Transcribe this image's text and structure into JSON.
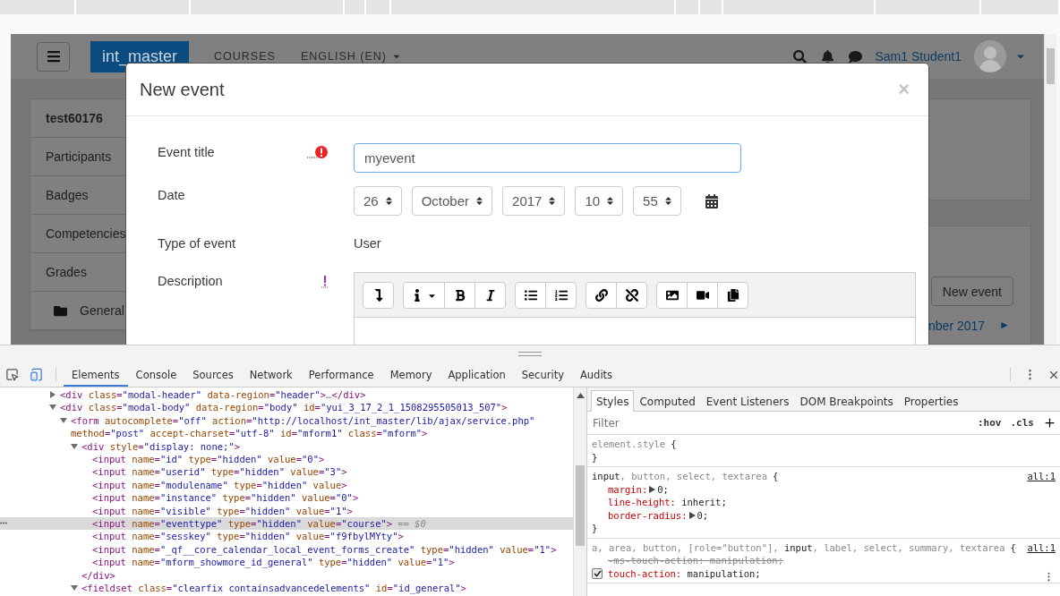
{
  "page": {
    "navbar": {
      "brand": "int_master",
      "links": [
        {
          "label": "COURSES"
        },
        {
          "label": "ENGLISH (EN)",
          "dropdown": true
        }
      ],
      "user_name": "Sam1 Student1"
    },
    "sidebar": {
      "items": [
        {
          "label": "test60176",
          "kind": "heading"
        },
        {
          "label": "Participants",
          "kind": "link"
        },
        {
          "label": "Badges",
          "kind": "link"
        },
        {
          "label": "Competencies",
          "kind": "link"
        },
        {
          "label": "Grades",
          "kind": "link"
        },
        {
          "label": "General",
          "kind": "folder"
        }
      ]
    },
    "calendar": {
      "button": "New event",
      "month": "nber 2017",
      "next": "►"
    }
  },
  "modal": {
    "title": "New event",
    "close": "×",
    "fields": [
      {
        "label": "Event title",
        "kind": "text",
        "error": true,
        "value": "myevent"
      },
      {
        "label": "Date",
        "kind": "date",
        "parts": [
          {
            "value": "26"
          },
          {
            "value": "October"
          },
          {
            "value": "2017"
          },
          {
            "value": "10"
          },
          {
            "value": "55"
          }
        ]
      },
      {
        "label": "Type of event",
        "kind": "static",
        "value": "User"
      },
      {
        "label": "Description",
        "kind": "editor",
        "required": true,
        "toolbar": [
          [
            {
              "kind": "collapse"
            }
          ],
          [
            {
              "kind": "info",
              "dropdown": true
            },
            {
              "kind": "bold"
            },
            {
              "kind": "italic"
            }
          ],
          [
            {
              "kind": "bullets"
            },
            {
              "kind": "numbering"
            }
          ],
          [
            {
              "kind": "link"
            },
            {
              "kind": "unlink"
            }
          ],
          [
            {
              "kind": "image"
            },
            {
              "kind": "video"
            },
            {
              "kind": "files"
            }
          ]
        ]
      }
    ]
  },
  "devtools": {
    "tabs": [
      {
        "label": "Elements",
        "selected": true
      },
      {
        "label": "Console",
        "selected": false
      },
      {
        "label": "Sources",
        "selected": false
      },
      {
        "label": "Network",
        "selected": false
      },
      {
        "label": "Performance",
        "selected": false
      },
      {
        "label": "Memory",
        "selected": false
      },
      {
        "label": "Application",
        "selected": false
      },
      {
        "label": "Security",
        "selected": false
      },
      {
        "label": "Audits",
        "selected": false
      }
    ],
    "dom_tree": [
      {
        "text": "<div class=\"modal-header\" data-region=\"header\">…</div>",
        "expanded": false,
        "selected": false
      },
      {
        "text": "<div class=\"modal-body\" data-region=\"body\" id=\"yui_3_17_2_1_1508295505013_507\">",
        "expanded": true,
        "selected": false,
        "children": [
          {
            "text": "<form autocomplete=\"off\" action=\"http://localhost/int_master/lib/ajax/service.php\" method=\"post\" accept-charset=\"utf-8\" id=\"mform1\" class=\"mform\">",
            "expanded": true,
            "selected": false,
            "children": [
              {
                "text": "<div style=\"display: none;\">",
                "expanded": true,
                "selected": false,
                "close": "</div>",
                "children": [
                  {
                    "text": "<input name=\"id\" type=\"hidden\" value=\"0\">",
                    "selected": false
                  },
                  {
                    "text": "<input name=\"userid\" type=\"hidden\" value=\"3\">",
                    "selected": false
                  },
                  {
                    "text": "<input name=\"modulename\" type=\"hidden\" value>",
                    "selected": false
                  },
                  {
                    "text": "<input name=\"instance\" type=\"hidden\" value=\"0\">",
                    "selected": false
                  },
                  {
                    "text": "<input name=\"visible\" type=\"hidden\" value=\"1\">",
                    "selected": false
                  },
                  {
                    "text": "<input name=\"eventtype\" type=\"hidden\" value=\"course\">",
                    "selected": true,
                    "badge": "== $0"
                  },
                  {
                    "text": "<input name=\"sesskey\" type=\"hidden\" value=\"f9fbylMYty\">",
                    "selected": false
                  },
                  {
                    "text": "<input name=\"_qf__core_calendar_local_event_forms_create\" type=\"hidden\" value=\"1\">",
                    "selected": false
                  },
                  {
                    "text": "<input name=\"mform_showmore_id_general\" type=\"hidden\" value=\"1\">",
                    "selected": false
                  }
                ]
              },
              {
                "text": "<fieldset class=\"clearfix containsadvancedelements\" id=\"id_general\">",
                "expanded": true,
                "selected": false
              }
            ]
          }
        ]
      }
    ],
    "styles": {
      "tabs": [
        {
          "label": "Styles",
          "selected": true
        },
        {
          "label": "Computed",
          "selected": false
        },
        {
          "label": "Event Listeners",
          "selected": false
        },
        {
          "label": "DOM Breakpoints",
          "selected": false
        },
        {
          "label": "Properties",
          "selected": false
        }
      ],
      "filter": {
        "placeholder": "Filter"
      },
      "hov": ":hov",
      "cls": ".cls",
      "rules": [
        {
          "selector": [
            {
              "text": "element.style",
              "matched": false
            }
          ],
          "open": "{",
          "close": "}"
        },
        {
          "selector": [
            {
              "text": "input",
              "matched": true
            },
            {
              "text": ", button, select, textarea",
              "matched": false
            }
          ],
          "source": "all:1",
          "open": "{",
          "close": "}",
          "declarations": [
            {
              "name": "margin:",
              "value": "0;",
              "expandable": true,
              "overridden": false
            },
            {
              "name": "line-height:",
              "value": "inherit;",
              "overridden": false
            },
            {
              "name": "border-radius:",
              "value": "0;",
              "expandable": true,
              "overridden": false
            }
          ]
        },
        {
          "selector": [
            {
              "text": "a, area, button, [role=\"button\"], ",
              "matched": false
            },
            {
              "text": "input",
              "matched": true
            },
            {
              "text": ", label, select, summary, textarea",
              "matched": false
            }
          ],
          "source": "all:1",
          "open": "{",
          "declarations": [
            {
              "name": "-ms-touch-action:",
              "value": "manipulation;",
              "overridden": true
            },
            {
              "name": "touch-action:",
              "value": "manipulation;",
              "overridden": false,
              "checked": true
            }
          ]
        }
      ]
    }
  }
}
